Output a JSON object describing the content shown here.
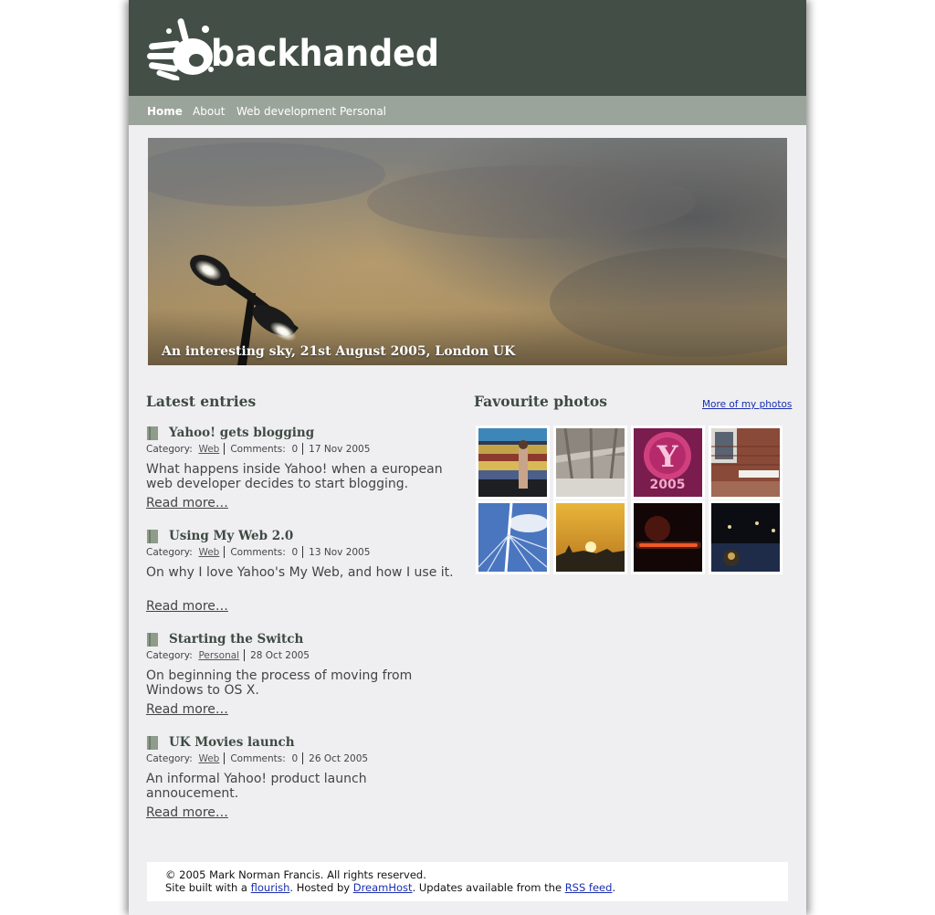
{
  "site": {
    "logo_text": "backhanded",
    "colors": {
      "masthead": "#434f46",
      "nav_bar": "#9ba49a",
      "page_background": "#efeff1",
      "heading_text": "#3e4a42",
      "link_blue": "#1a2eb0"
    }
  },
  "nav": {
    "items": [
      {
        "label": "Home",
        "current": true
      },
      {
        "label": "About",
        "current": false
      },
      {
        "label": "Web development",
        "current": false
      },
      {
        "label": "Personal",
        "current": false
      }
    ]
  },
  "hero": {
    "caption": "An interesting sky, 21st August 2005, London UK"
  },
  "entries_section": {
    "heading": "Latest entries",
    "items": [
      {
        "title": "Yahoo! gets blogging",
        "category_label": "Category:",
        "category": "Web",
        "comments_label": "Comments:",
        "comments": "0",
        "date": "17 Nov 2005",
        "summary": "What happens inside Yahoo! when a european web developer decides to start blogging.",
        "read_more": "Read more…",
        "icon": "document-icon"
      },
      {
        "title": "Using My Web 2.0",
        "category_label": "Category:",
        "category": "Web",
        "comments_label": "Comments:",
        "comments": "0",
        "date": "13 Nov 2005",
        "summary": "On why I love Yahoo's My Web, and how I use it.",
        "read_more": "Read more…",
        "icon": "document-icon"
      },
      {
        "title": "Starting the Switch",
        "category_label": "Category:",
        "category": "Personal",
        "date": "28 Oct 2005",
        "summary": "On beginning the process of moving from Windows to OS X.",
        "read_more": "Read more…",
        "icon": "document-icon"
      },
      {
        "title": "UK Movies launch",
        "category_label": "Category:",
        "category": "Web",
        "comments_label": "Comments:",
        "comments": "0",
        "date": "26 Oct 2005",
        "summary": "An informal Yahoo! product launch annoucement.",
        "read_more": "Read more…",
        "icon": "document-icon"
      }
    ]
  },
  "photos_section": {
    "heading": "Favourite photos",
    "more_link": "More of my photos",
    "photos": [
      {
        "subject": "train-blur-photo"
      },
      {
        "subject": "station-roof-photo"
      },
      {
        "subject": "yahoo-ice-sculpture-photo"
      },
      {
        "subject": "brick-street-sign-photo"
      },
      {
        "subject": "bridge-cables-photo"
      },
      {
        "subject": "sunset-skyline-photo"
      },
      {
        "subject": "night-glow-photo"
      },
      {
        "subject": "pool-table-photo"
      }
    ]
  },
  "footer": {
    "copyright": "© 2005 Mark Norman Francis. All rights reserved.",
    "built_prefix": "Site built with a ",
    "built_link": "flourish",
    "hosted_prefix": ". Hosted by ",
    "host_link": "DreamHost",
    "updates_prefix": ". Updates available from the ",
    "rss_link": "RSS feed",
    "suffix": "."
  }
}
